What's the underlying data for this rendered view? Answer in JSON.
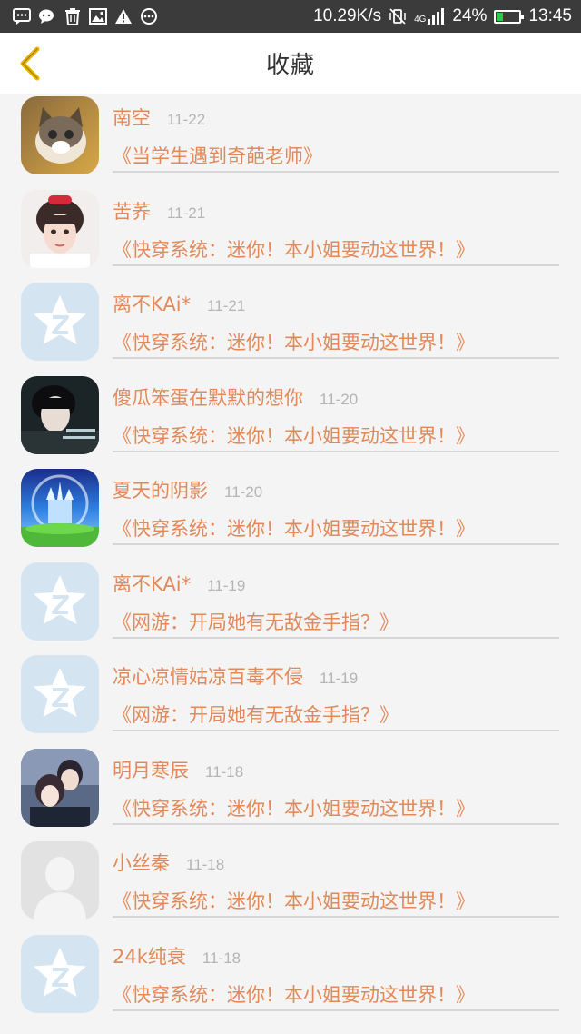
{
  "status_bar": {
    "speed": "10.29K/s",
    "network": "4G",
    "battery": "24%",
    "battery_level": 0.24,
    "time": "13:45",
    "left_icons": [
      "message-icon",
      "wechat-icon",
      "trash-icon",
      "image-icon",
      "warning-icon",
      "more-icon"
    ]
  },
  "header": {
    "title": "收藏",
    "accent_color": "#e8b500"
  },
  "list": {
    "items": [
      {
        "name": "南空",
        "date": "11-22",
        "book": "《当学生遇到奇葩老师》",
        "avatar": "cat"
      },
      {
        "name": "苦荞",
        "date": "11-21",
        "book": "《快穿系统：迷你！本小姐要动这世界！》",
        "avatar": "girl"
      },
      {
        "name": "离不KAi*",
        "date": "11-21",
        "book": "《快穿系统：迷你！本小姐要动这世界！》",
        "avatar": "qq"
      },
      {
        "name": "傻瓜笨蛋在默默的想你",
        "date": "11-20",
        "book": "《快穿系统：迷你！本小姐要动这世界！》",
        "avatar": "boy"
      },
      {
        "name": "夏天的阴影",
        "date": "11-20",
        "book": "《快穿系统：迷你！本小姐要动这世界！》",
        "avatar": "castle"
      },
      {
        "name": "离不KAi*",
        "date": "11-19",
        "book": "《网游：开局她有无敌金手指？》",
        "avatar": "qq"
      },
      {
        "name": "凉心凉情姑凉百毒不侵",
        "date": "11-19",
        "book": "《网游：开局她有无敌金手指？》",
        "avatar": "qq"
      },
      {
        "name": "明月寒辰",
        "date": "11-18",
        "book": "《快穿系统：迷你！本小姐要动这世界！》",
        "avatar": "couple"
      },
      {
        "name": "小丝秦",
        "date": "11-18",
        "book": "《快穿系统：迷你！本小姐要动这世界！》",
        "avatar": "default"
      },
      {
        "name": "24k纯衰",
        "date": "11-18",
        "book": "《快穿系统：迷你！本小姐要动这世界！》",
        "avatar": "qq"
      }
    ]
  },
  "colors": {
    "text_accent": "#e2895a",
    "date": "#b4b4b4",
    "qq_avatar_bg": "#d4e4f1"
  }
}
